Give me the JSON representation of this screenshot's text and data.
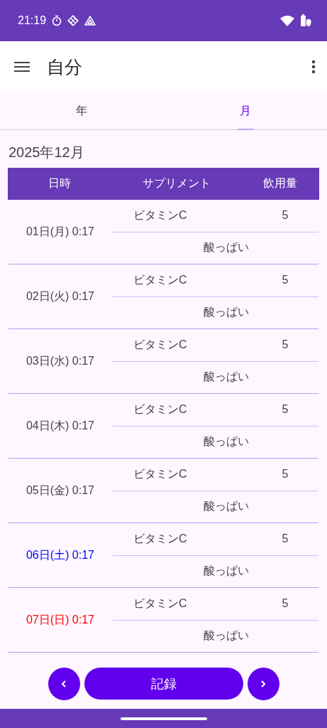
{
  "status_bar": {
    "time": "21:19"
  },
  "app_bar": {
    "title": "自分"
  },
  "tabs": [
    {
      "label": "年",
      "selected": false
    },
    {
      "label": "月",
      "selected": true
    }
  ],
  "month_title": "2025年12月",
  "table": {
    "columns": [
      "日時",
      "サプリメント",
      "飲用量"
    ],
    "rows": [
      {
        "date": "01日(月) 0:17",
        "kind": "weekday",
        "supplement": "ビタミンC",
        "amount": "5",
        "note": "酸っぱい"
      },
      {
        "date": "02日(火) 0:17",
        "kind": "weekday",
        "supplement": "ビタミンC",
        "amount": "5",
        "note": "酸っぱい"
      },
      {
        "date": "03日(水) 0:17",
        "kind": "weekday",
        "supplement": "ビタミンC",
        "amount": "5",
        "note": "酸っぱい"
      },
      {
        "date": "04日(木) 0:17",
        "kind": "weekday",
        "supplement": "ビタミンC",
        "amount": "5",
        "note": "酸っぱい"
      },
      {
        "date": "05日(金) 0:17",
        "kind": "weekday",
        "supplement": "ビタミンC",
        "amount": "5",
        "note": "酸っぱい"
      },
      {
        "date": "06日(土) 0:17",
        "kind": "saturday",
        "supplement": "ビタミンC",
        "amount": "5",
        "note": "酸っぱい"
      },
      {
        "date": "07日(日) 0:17",
        "kind": "sunday",
        "supplement": "ビタミンC",
        "amount": "5",
        "note": "酸っぱい"
      }
    ]
  },
  "record_button": "記録"
}
